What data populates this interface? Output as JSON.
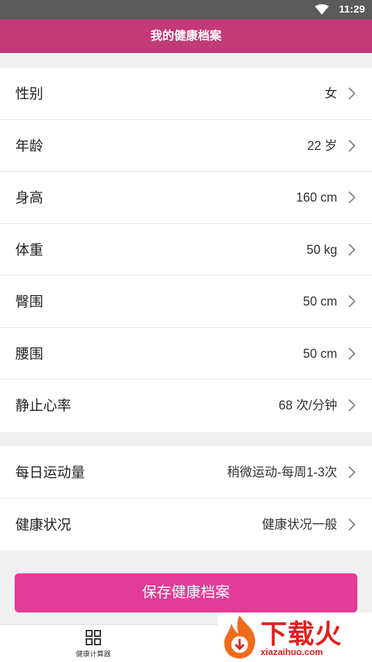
{
  "status_bar": {
    "time": "11:29"
  },
  "header": {
    "title": "我的健康档案"
  },
  "profile": [
    {
      "label": "性别",
      "value": "女"
    },
    {
      "label": "年龄",
      "value": "22 岁"
    },
    {
      "label": "身高",
      "value": "160 cm"
    },
    {
      "label": "体重",
      "value": "50 kg"
    },
    {
      "label": "臀围",
      "value": "50 cm"
    },
    {
      "label": "腰围",
      "value": "50 cm"
    },
    {
      "label": "静止心率",
      "value": "68 次/分钟"
    }
  ],
  "lifestyle": [
    {
      "label": "每日运动量",
      "value": "稍微运动-每周1-3次"
    },
    {
      "label": "健康状况",
      "value": "健康状况一般"
    }
  ],
  "save_button": {
    "label": "保存健康档案"
  },
  "tab_bar": {
    "items": [
      {
        "label": "健康计算器"
      }
    ]
  },
  "watermark": {
    "text": "下载火",
    "url": "xiazaihuo.com"
  },
  "colors": {
    "header": "#c23a78",
    "button": "#e23b98",
    "status_bar": "#5b5b5b",
    "watermark": "#e0201f"
  }
}
